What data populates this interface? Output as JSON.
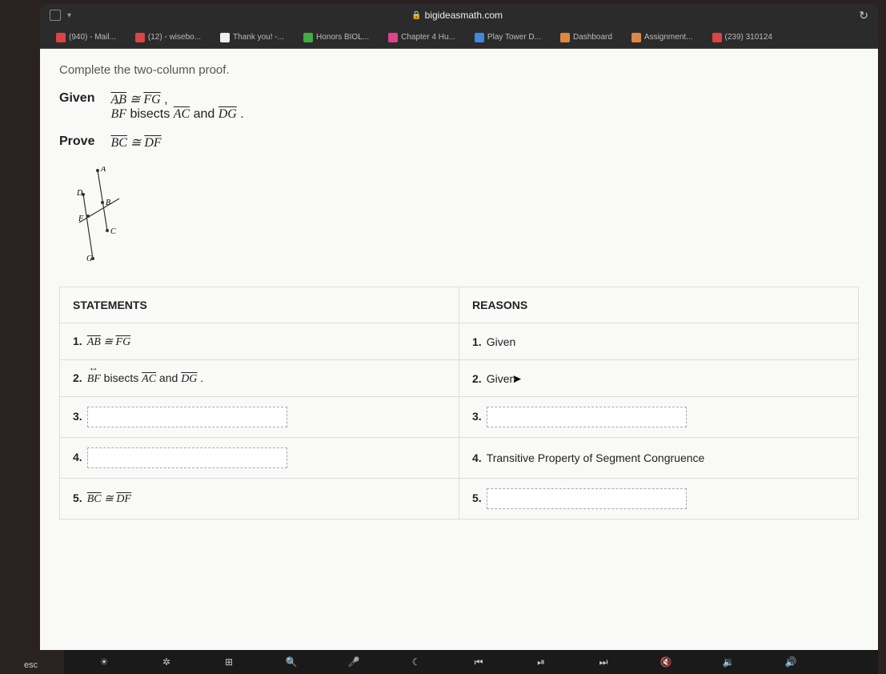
{
  "browser": {
    "url": "bigideasmath.com"
  },
  "bookmarks": [
    {
      "label": "(940) - Mail...",
      "icon": "bm-red"
    },
    {
      "label": "(12) - wisebo...",
      "icon": "bm-red"
    },
    {
      "label": "Thank you! -...",
      "icon": "bm-white"
    },
    {
      "label": "Honors BIOL...",
      "icon": "bm-green"
    },
    {
      "label": "Chapter 4 Hu...",
      "icon": "bm-pink"
    },
    {
      "label": "Play Tower D...",
      "icon": "bm-blue"
    },
    {
      "label": "Dashboard",
      "icon": "bm-orange"
    },
    {
      "label": "Assignment...",
      "icon": "bm-orange"
    },
    {
      "label": "(239) 310124",
      "icon": "bm-red"
    }
  ],
  "page": {
    "instruction": "Complete the two-column proof.",
    "given_label": "Given",
    "given_line1_a": "AB",
    "given_line1_cong": " ≅ ",
    "given_line1_b": "FG",
    "given_line1_tail": " ,",
    "given_line2_a": "BF",
    "given_line2_mid": "  bisects  ",
    "given_line2_b": "AC",
    "given_line2_and": "  and  ",
    "given_line2_c": "DG",
    "given_line2_tail": " .",
    "prove_label": "Prove",
    "prove_a": "BC",
    "prove_cong": " ≅ ",
    "prove_b": "DF",
    "diagram_labels": {
      "A": "A",
      "B": "B",
      "C": "C",
      "D": "D",
      "F": "F",
      "G": "G"
    }
  },
  "table": {
    "headers": {
      "statements": "STATEMENTS",
      "reasons": "REASONS"
    },
    "rows": [
      {
        "num": "1.",
        "stmt_a": "AB",
        "stmt_cong": " ≅ ",
        "stmt_b": "FG",
        "reason": "Given"
      },
      {
        "num": "2.",
        "stmt_a": "BF",
        "stmt_mid": "  bisects  ",
        "stmt_b": "AC",
        "stmt_and": "  and  ",
        "stmt_c": "DG",
        "stmt_tail": " .",
        "reason": "Given"
      },
      {
        "num": "3.",
        "stmt_input": true,
        "reason_input": true
      },
      {
        "num": "4.",
        "stmt_input": true,
        "reason": "Transitive Property of Segment Congruence"
      },
      {
        "num": "5.",
        "stmt_a": "BC",
        "stmt_cong": " ≅ ",
        "stmt_b": "DF",
        "reason_input": true
      }
    ]
  },
  "keyboard": {
    "esc": "esc",
    "keys": [
      "☀",
      "✲",
      "⊞",
      "🔍",
      "🎤",
      "☾",
      "⏮",
      "⏯",
      "⏭",
      "🔇",
      "🔉",
      "🔊"
    ]
  }
}
